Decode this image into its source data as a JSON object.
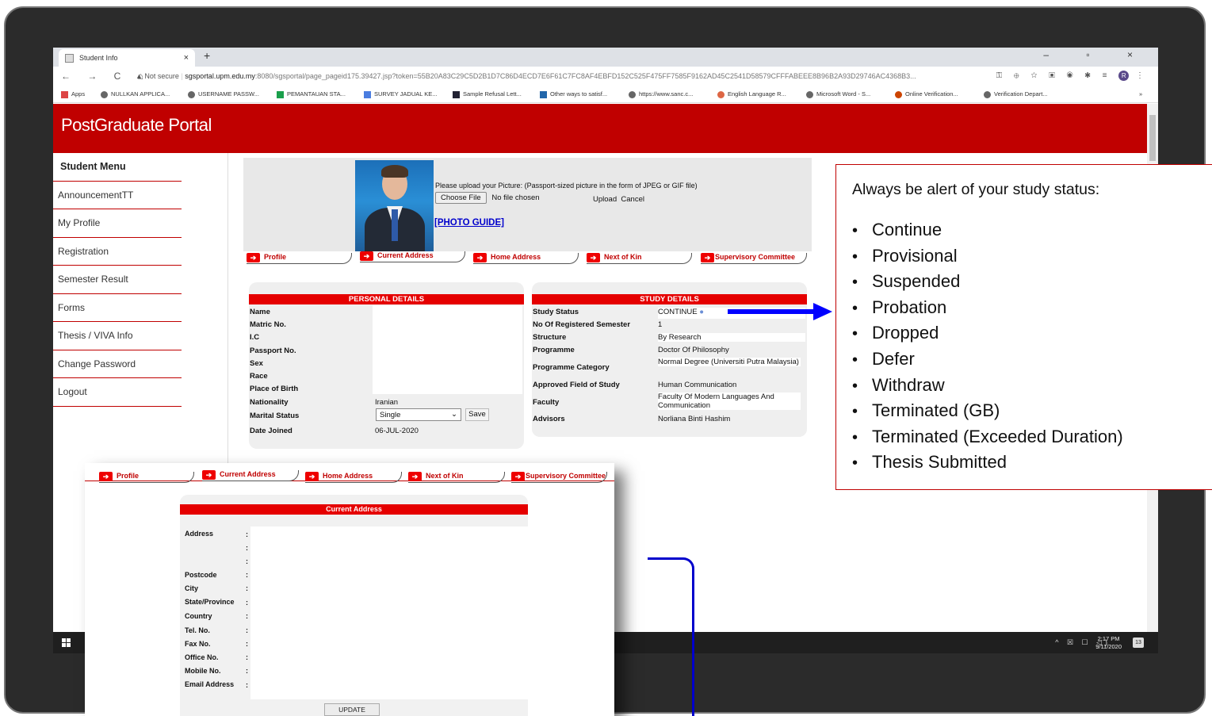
{
  "browser": {
    "tab_title": "Student Info",
    "tab_close": "×",
    "new_tab": "+",
    "window_controls": "– ▫ ×",
    "nav_buttons": "← → C ⌂",
    "url_not_secure": "▲ Not secure",
    "url_domain": "sgsportal.upm.edu.my",
    "url_path": ":8080/sgsportal/page_pageid175.39427.jsp?token=55B20A83C29C5D2B1D7C86D4ECD7E6F61C7FC8AF4EBFD152C525F475FF7585F9162AD45C2541D58579CFFFABEEE8B96B2A93D29746AC4368B3...",
    "bookmarks": [
      "Apps",
      "NULLKAN APPLICA...",
      "USERNAME PASSW...",
      "PEMANTAUAN STA...",
      "SURVEY JADUAL KE...",
      "Sample Refusal Lett...",
      "Other ways to satisf...",
      "https://www.sanc.c...",
      "English Language R...",
      "Microsoft Word - S...",
      "Online Verification...",
      "Verification Depart..."
    ],
    "bookmarks_more": "»",
    "profile_initial": "R"
  },
  "portal": {
    "title": "PostGraduate Portal"
  },
  "sidebar": {
    "items": [
      "Student Menu",
      "AnnouncementTT",
      "My Profile",
      "Registration",
      "Semester Result",
      "Forms",
      "Thesis / VIVA Info",
      "Change Password",
      "Logout"
    ]
  },
  "photo_upload": {
    "instruction": "Please upload your Picture: (Passport-sized picture in the form of JPEG or GIF file)",
    "choose_file": "Choose File",
    "no_file": "No file chosen",
    "upload": "Upload",
    "cancel": "Cancel",
    "photo_guide": "[PHOTO GUIDE]"
  },
  "nav_tabs": [
    "Profile",
    "Current Address",
    "Home Address",
    "Next of Kin",
    "Supervisory Committee"
  ],
  "personal_details": {
    "title": "PERSONAL DETAILS",
    "rows": [
      {
        "label": "Name",
        "value": ""
      },
      {
        "label": "Matric No.",
        "value": ""
      },
      {
        "label": "I.C",
        "value": ""
      },
      {
        "label": "Passport No.",
        "value": ""
      },
      {
        "label": "Sex",
        "value": ""
      },
      {
        "label": "Race",
        "value": ""
      },
      {
        "label": "Place of Birth",
        "value": ""
      },
      {
        "label": "Nationality",
        "value": "Iranian"
      },
      {
        "label": "Marital Status",
        "value": "Single"
      },
      {
        "label": "Date Joined",
        "value": "06-JUL-2020"
      }
    ],
    "save": "Save"
  },
  "study_details": {
    "title": "STUDY DETAILS",
    "rows": [
      {
        "label": "Study Status",
        "value": "CONTINUE"
      },
      {
        "label": "No Of Registered Semester",
        "value": "1"
      },
      {
        "label": "Structure",
        "value": "By Research"
      },
      {
        "label": "Programme",
        "value": "Doctor Of Philosophy"
      },
      {
        "label": "Programme Category",
        "value": "Normal Degree (Universiti Putra Malaysia)"
      },
      {
        "label": "Approved Field of Study",
        "value": "Human Communication"
      },
      {
        "label": "Faculty",
        "value": "Faculty Of Modern Languages And Communication"
      },
      {
        "label": "Advisors",
        "value": "Norliana Binti Hashim"
      }
    ]
  },
  "callout": {
    "title": "Always be alert of your study status:",
    "items": [
      "Continue",
      "Provisional",
      "Suspended",
      "Probation",
      "Dropped",
      "Defer",
      "Withdraw",
      "Terminated (GB)",
      "Terminated (Exceeded Duration)",
      "Thesis Submitted"
    ]
  },
  "current_address": {
    "title": "Current Address",
    "labels": [
      "Address",
      "",
      "",
      "Postcode",
      "City",
      "State/Province",
      "Country",
      "Tel. No.",
      "Fax No.",
      "Office No.",
      "Mobile No.",
      "Email Address"
    ],
    "colon": ":",
    "update": "UPDATE"
  },
  "taskbar": {
    "tray_icons": "^ ☒ ☐ ◁)",
    "time": "2:17 PM",
    "date": "9/11/2020",
    "notifications": "13"
  },
  "colors": {
    "portal_red": "#c00000",
    "header_red": "#e50000",
    "link_blue": "#0000cc",
    "arrow_blue": "#0000ff"
  }
}
